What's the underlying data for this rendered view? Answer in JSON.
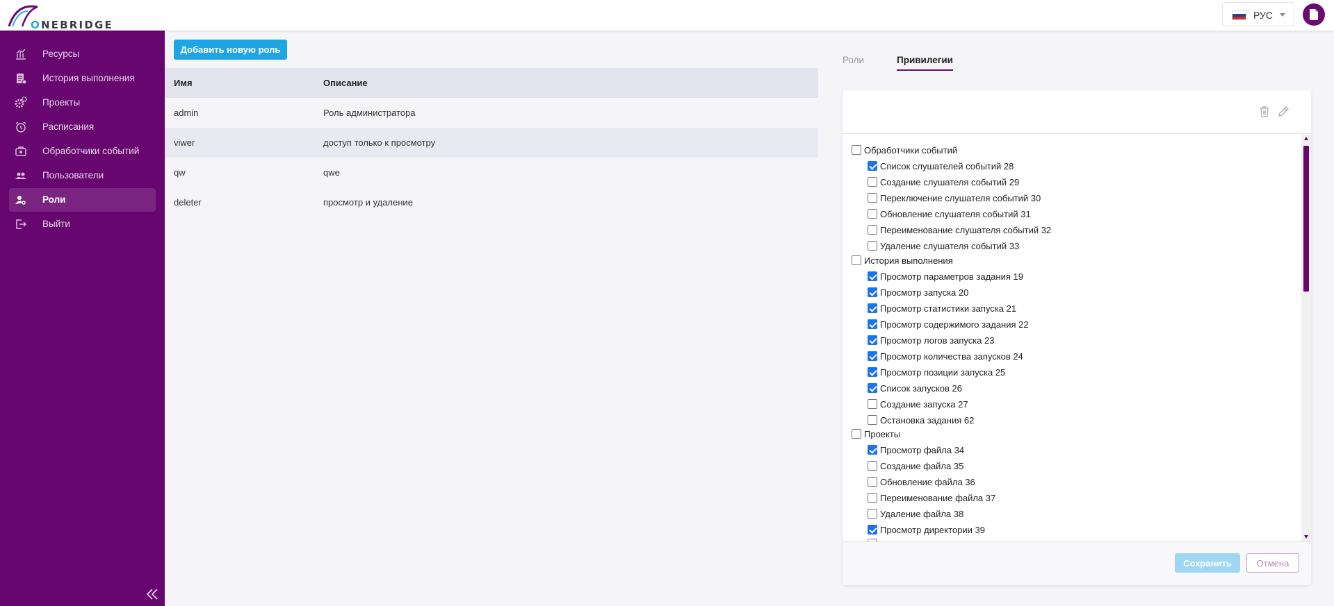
{
  "brand": {
    "name_first": "O",
    "name_rest": "NEBRIDGE",
    "accent": "#680670",
    "logo_icon": "bridge-arc-logo"
  },
  "header": {
    "language": {
      "label": "РУС",
      "icon": "russia-flag-icon"
    },
    "user_icon": "document-user-icon"
  },
  "sidebar": {
    "background": "#680670",
    "items": [
      {
        "label": "Ресурсы",
        "icon": "bar-chart-icon",
        "active": false
      },
      {
        "label": "История выполнения",
        "icon": "history-list-icon",
        "active": false
      },
      {
        "label": "Проекты",
        "icon": "gears-icon",
        "active": false
      },
      {
        "label": "Расписания",
        "icon": "alarm-clock-icon",
        "active": false
      },
      {
        "label": "Обработчики событий",
        "icon": "event-handler-icon",
        "active": false
      },
      {
        "label": "Пользователи",
        "icon": "users-icon",
        "active": false
      },
      {
        "label": "Роли",
        "icon": "user-key-icon",
        "active": true
      },
      {
        "label": "Выйти",
        "icon": "logout-icon",
        "active": false
      }
    ],
    "collapse_icon": "double-chevron-left-icon"
  },
  "roles": {
    "add_button": "Добавить новую роль",
    "columns": {
      "name": "Имя",
      "description": "Описание"
    },
    "rows": [
      {
        "name": "admin",
        "description": "Роль администратора"
      },
      {
        "name": "viwer",
        "description": "доступ только к просмотру"
      },
      {
        "name": "qw",
        "description": "qwe"
      },
      {
        "name": "deleter",
        "description": "просмотр и удаление"
      }
    ]
  },
  "tabs": {
    "roles": "Роли",
    "privileges": "Привилегии",
    "active": "privileges"
  },
  "privileges": {
    "toolbar_icons": [
      "trash-icon",
      "pencil-icon"
    ],
    "groups": [
      {
        "label": "Обработчики событий",
        "checked": false,
        "items": [
          {
            "label": "Список слушателей событий 28",
            "checked": true
          },
          {
            "label": "Создание слушателя событий 29",
            "checked": false
          },
          {
            "label": "Переключение слушателя событий 30",
            "checked": false
          },
          {
            "label": "Обновление слушателя событий 31",
            "checked": false
          },
          {
            "label": "Переименование слушателя событий 32",
            "checked": false
          },
          {
            "label": "Удаление слушателя событий 33",
            "checked": false
          }
        ]
      },
      {
        "label": "История выполнения",
        "checked": false,
        "items": [
          {
            "label": "Просмотр параметров задания 19",
            "checked": true
          },
          {
            "label": "Просмотр запуска 20",
            "checked": true
          },
          {
            "label": "Просмотр статистики запуска 21",
            "checked": true
          },
          {
            "label": "Просмотр содержимого задания 22",
            "checked": true
          },
          {
            "label": "Просмотр логов запуска 23",
            "checked": true
          },
          {
            "label": "Просмотр количества запусков 24",
            "checked": true
          },
          {
            "label": "Просмотр позиции запуска 25",
            "checked": true
          },
          {
            "label": "Список запусков 26",
            "checked": true
          },
          {
            "label": "Создание запуска 27",
            "checked": false
          },
          {
            "label": "Остановка задания 62",
            "checked": false
          }
        ]
      },
      {
        "label": "Проекты",
        "checked": false,
        "items": [
          {
            "label": "Просмотр файла 34",
            "checked": true
          },
          {
            "label": "Создание файла 35",
            "checked": false
          },
          {
            "label": "Обновление файла 36",
            "checked": false
          },
          {
            "label": "Переименование файла 37",
            "checked": false
          },
          {
            "label": "Удаление файла 38",
            "checked": false
          },
          {
            "label": "Просмотр директории 39",
            "checked": true
          }
        ]
      }
    ],
    "save_button": "Сохранить",
    "cancel_button": "Отмена"
  }
}
